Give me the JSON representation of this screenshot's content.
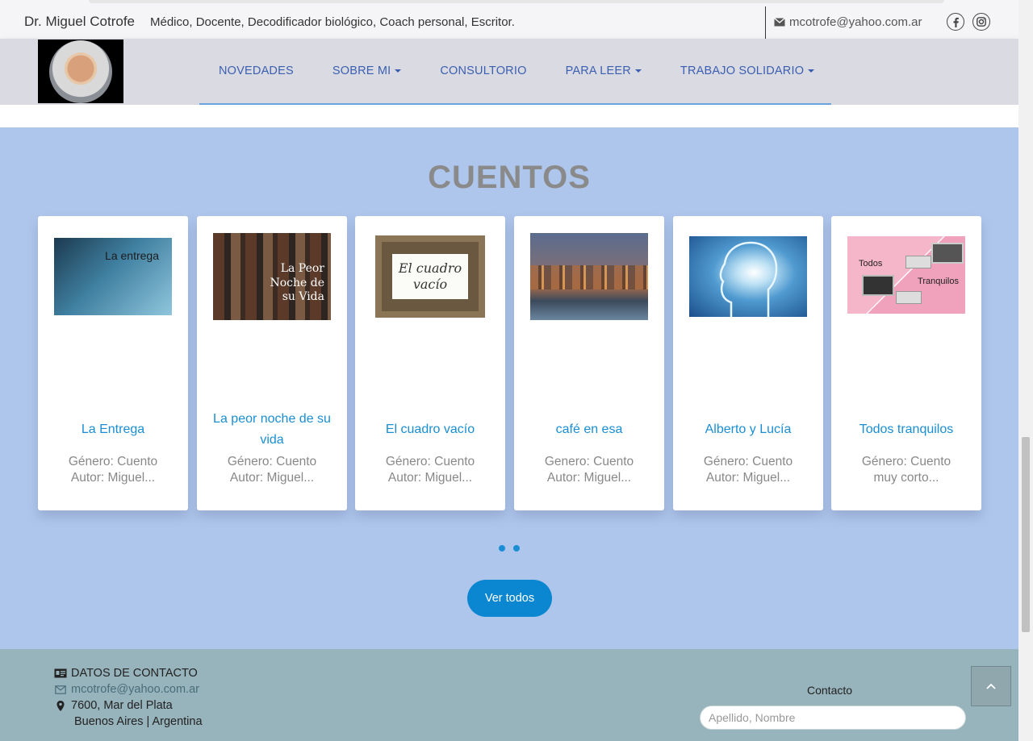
{
  "header": {
    "brand_name": "Dr. Miguel Cotrofe",
    "tagline": "Médico, Docente, Decodificador biológico, Coach personal, Escritor.",
    "email": "mcotrofe@yahoo.com.ar"
  },
  "nav": {
    "items": [
      {
        "label": "NOVEDADES",
        "dropdown": false
      },
      {
        "label": "SOBRE MI",
        "dropdown": true
      },
      {
        "label": "CONSULTORIO",
        "dropdown": false
      },
      {
        "label": "PARA LEER",
        "dropdown": true
      },
      {
        "label": "TRABAJO SOLIDARIO",
        "dropdown": true
      }
    ]
  },
  "section": {
    "title": "CUENTOS",
    "cards": [
      {
        "thumb_text": "La entrega",
        "title": "La Entrega",
        "meta1": "Género: Cuento",
        "meta2": "Autor: Miguel..."
      },
      {
        "thumb_text": "La Peor Noche de su Vida",
        "title": "La peor noche de su vida",
        "meta1": "Género: Cuento",
        "meta2": "Autor: Miguel..."
      },
      {
        "thumb_text": "El cuadro vacío",
        "title": "El cuadro vacío",
        "meta1": "Género: Cuento",
        "meta2": "Autor: Miguel..."
      },
      {
        "thumb_text": "",
        "title": "café en esa",
        "meta1": "Genero: Cuento",
        "meta2": "Autor: Miguel..."
      },
      {
        "thumb_text": "",
        "title": "Alberto y Lucía",
        "meta1": "Género: Cuento",
        "meta2": "Autor: Miguel..."
      },
      {
        "thumb_text_a": "Todos",
        "thumb_text_b": "Tranquilos",
        "title": "Todos tranquilos",
        "meta1": "Género: Cuento",
        "meta2": "muy corto..."
      }
    ],
    "button_label": "Ver todos"
  },
  "footer": {
    "heading": "DATOS DE CONTACTO",
    "email": "mcotrofe@yahoo.com.ar",
    "address1": "7600, Mar del Plata",
    "address2": "Buenos Aires | Argentina",
    "contact_label": "Contacto",
    "contact_placeholder": "Apellido, Nombre"
  },
  "colors": {
    "section_bg": "#afc6ec",
    "link_blue": "#1a8ed4",
    "nav_blue": "#3b5fb0",
    "footer_bg": "#97b3bb"
  },
  "icons": [
    "envelope-icon",
    "facebook-icon",
    "instagram-icon",
    "id-card-icon",
    "map-marker-icon",
    "chevron-up-icon"
  ]
}
